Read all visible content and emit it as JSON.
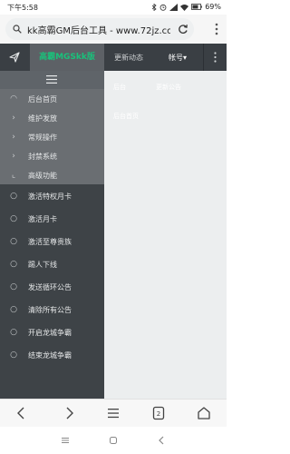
{
  "status_bar": {
    "time": "下午5:58",
    "battery": "69%"
  },
  "browser": {
    "url": "kk高霸GM后台工具 - www.72jz.co"
  },
  "top_nav": {
    "brand": "高霸MGSkk版",
    "item1": "更新动态",
    "item2": "帐号"
  },
  "sidebar": {
    "sub_items": [
      {
        "icon": "home-outline-icon",
        "label": "后台首页"
      },
      {
        "icon": "chevron-right-icon",
        "label": "维护发放"
      },
      {
        "icon": "chevron-right-icon",
        "label": "常规操作"
      },
      {
        "icon": "chevron-right-icon",
        "label": "封禁系统"
      },
      {
        "icon": "corner-down-right-icon",
        "label": "高级功能"
      }
    ],
    "main_items": [
      {
        "label": "激活特权月卡"
      },
      {
        "label": "激活月卡"
      },
      {
        "label": "激活至尊贵族"
      },
      {
        "label": "踢人下线"
      },
      {
        "label": "发送循环公告"
      },
      {
        "label": "清除所有公告"
      },
      {
        "label": "开启龙城争霸"
      },
      {
        "label": "结束龙城争霸"
      }
    ]
  },
  "content_dim": {
    "tab1": "后台",
    "tab2": "更新公告",
    "row1": "后台首页"
  },
  "colors": {
    "brand_green": "#19c27b",
    "nav_dark": "#3a3f44",
    "sidebar": "#3e4347"
  }
}
